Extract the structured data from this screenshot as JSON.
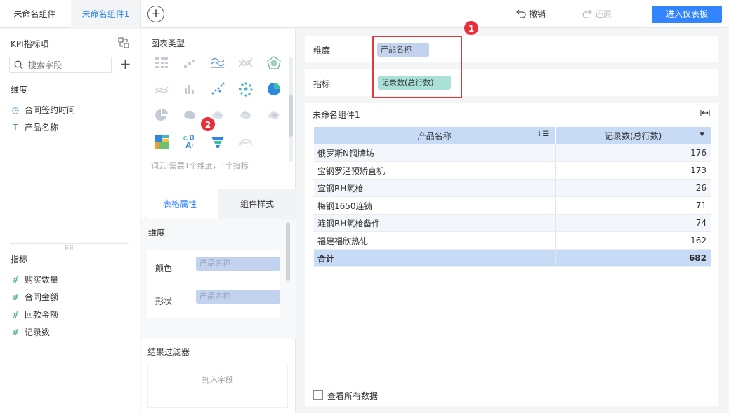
{
  "tabs": [
    {
      "label": "未命名组件"
    },
    {
      "label": "未命名组件1"
    }
  ],
  "toolbar": {
    "undo_label": "撤销",
    "redo_label": "还原",
    "enter_dashboard_label": "进入仪表板"
  },
  "left_panel": {
    "title": "KPI指标项",
    "search_placeholder": "搜索字段",
    "dimension_heading": "维度",
    "dimensions": [
      {
        "label": "合同签约时间",
        "icon": "clock-icon"
      },
      {
        "label": "产品名称",
        "icon": "text-type-icon"
      }
    ],
    "measure_heading": "指标",
    "measures": [
      {
        "label": "购买数量",
        "icon": "hash-icon"
      },
      {
        "label": "合同金额",
        "icon": "hash-icon"
      },
      {
        "label": "回款金额",
        "icon": "hash-icon"
      },
      {
        "label": "记录数",
        "icon": "hash-icon"
      }
    ]
  },
  "chart_types": {
    "heading": "图表类型",
    "hint": "词云:需要1个维度，1个指标"
  },
  "property_tabs": {
    "table_props": "表格属性",
    "component_style": "组件样式"
  },
  "properties": {
    "dimension_heading": "维度",
    "color_label": "颜色",
    "color_value": "产品名称",
    "shape_label": "形状",
    "shape_value": "产品名称"
  },
  "filter": {
    "heading": "结果过滤器",
    "drop_hint": "拖入字段"
  },
  "config": {
    "dimension_label": "维度",
    "dimension_value": "产品名称",
    "measure_label": "指标",
    "measure_value": "记录数(总行数)"
  },
  "markers": {
    "one": "1",
    "two": "2"
  },
  "component": {
    "title": "未命名组件1",
    "table": {
      "headers": [
        "产品名称",
        "记录数(总行数)"
      ],
      "rows": [
        [
          "俄罗斯N钢牌坊",
          "176"
        ],
        [
          "宝钢罗泾预矫直机",
          "173"
        ],
        [
          "宣钢RH氧枪",
          "26"
        ],
        [
          "梅钢1650连铸",
          "71"
        ],
        [
          "涟钢RH氧枪备件",
          "74"
        ],
        [
          "福建福欣热轧",
          "162"
        ]
      ],
      "total": [
        "合计",
        "682"
      ]
    },
    "view_all_label": "查看所有数据"
  },
  "colors": {
    "accent": "#3385ff",
    "marker": "#e4393c",
    "header_row": "#c7dbf7"
  }
}
